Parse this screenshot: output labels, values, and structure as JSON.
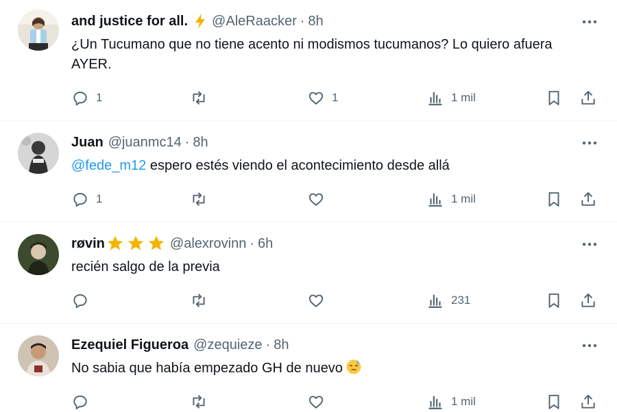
{
  "tweets": [
    {
      "name": "and justice for all.",
      "badge": "lightning-emoji",
      "handle": "@AleRaacker",
      "separator": "·",
      "time": "8h",
      "text": "¿Un Tucumano que no tiene acento ni modismos tucumanos? Lo quiero afuera AYER.",
      "replies": "1",
      "reposts": "",
      "likes": "1",
      "views": "1 mil"
    },
    {
      "name": "Juan",
      "handle": "@juanmc14",
      "separator": "·",
      "time": "8h",
      "mention": "@fede_m12",
      "text": " espero estés viendo el acontecimiento desde allá",
      "replies": "1",
      "reposts": "",
      "likes": "",
      "views": "1 mil"
    },
    {
      "name": "røvin",
      "badge": "three-star-emojis",
      "handle": "@alexrovinn",
      "separator": "·",
      "time": "6h",
      "text": "recién salgo de la previa",
      "replies": "",
      "reposts": "",
      "likes": "",
      "views": "231"
    },
    {
      "name": "Ezequiel Figueroa",
      "handle": "@zequieze",
      "separator": "·",
      "time": "8h",
      "text": "No sabia que había empezado GH de nuevo",
      "emoji": "downcast-face-with-sweat-emoji",
      "replies": "",
      "reposts": "",
      "likes": "",
      "views": "1 mil"
    }
  ],
  "icons": {
    "reply": "reply-icon",
    "repost": "repost-icon",
    "like": "like-icon",
    "views": "views-icon",
    "bookmark": "bookmark-icon",
    "share": "share-icon",
    "more": "more-icon"
  },
  "colors": {
    "text": "#0f1419",
    "secondary": "#536471",
    "link": "#1d9bf0",
    "divider": "#eff3f4"
  }
}
